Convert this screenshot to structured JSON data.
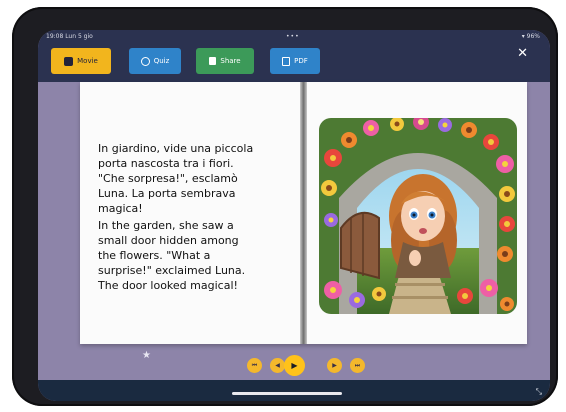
{
  "status": {
    "time": "19:08 Lun 5 gio",
    "dots": "•••",
    "right": "▾ 96%"
  },
  "toolbar": {
    "movie_label": "Movie",
    "quiz_label": "Quiz",
    "share_label": "Share",
    "pdf_label": "PDF",
    "close_label": "✕",
    "colors": {
      "movie": "#f2b51d",
      "quiz": "#2f83c9",
      "share": "#3c9a59",
      "pdf": "#2f83c9"
    }
  },
  "book": {
    "text_it": "In giardino, vide una piccola\nporta nascosta tra i fiori.\n\"Che sorpresa!\", esclamò\nLuna. La porta sembrava\nmagica!",
    "text_en": "In the garden, she saw a\nsmall door hidden among\nthe flowers. \"What a\nsurprise!\" exclaimed Luna.\nThe door looked magical!",
    "illustration": "girl-in-flower-archway-illustration"
  },
  "controls": {
    "icons": [
      "first-page-icon",
      "previous-page-icon",
      "play-icon",
      "next-page-icon",
      "last-page-icon"
    ],
    "glyphs": {
      "first": "⏮",
      "prev": "◀",
      "play": "▶",
      "next": "▶",
      "last": "⏭"
    }
  },
  "misc": {
    "star": "★",
    "resize": "⤡"
  }
}
